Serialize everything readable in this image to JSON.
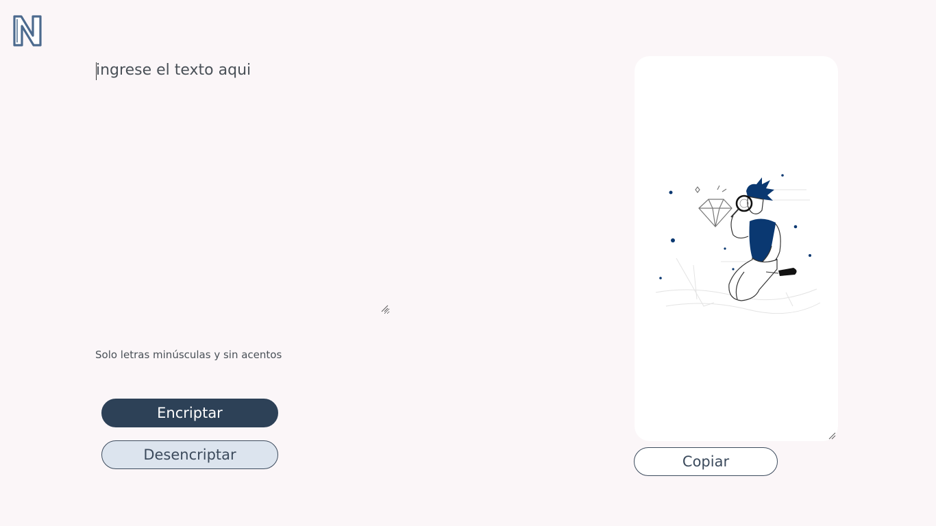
{
  "app": {
    "logo_icon": "n-logo-icon"
  },
  "encoder": {
    "input_placeholder": "ingrese el texto aqui",
    "input_value": "",
    "hint": "Solo letras minúsculas y sin acentos",
    "encrypt_label": "Encriptar",
    "decrypt_label": "Desencriptar"
  },
  "output": {
    "illustration": "person-with-magnifier-illustration",
    "copy_label": "Copiar"
  },
  "colors": {
    "background": "#FBF6F8",
    "primary": "#2D4157",
    "secondary": "#DCE4EE",
    "accent": "#0A3871"
  }
}
